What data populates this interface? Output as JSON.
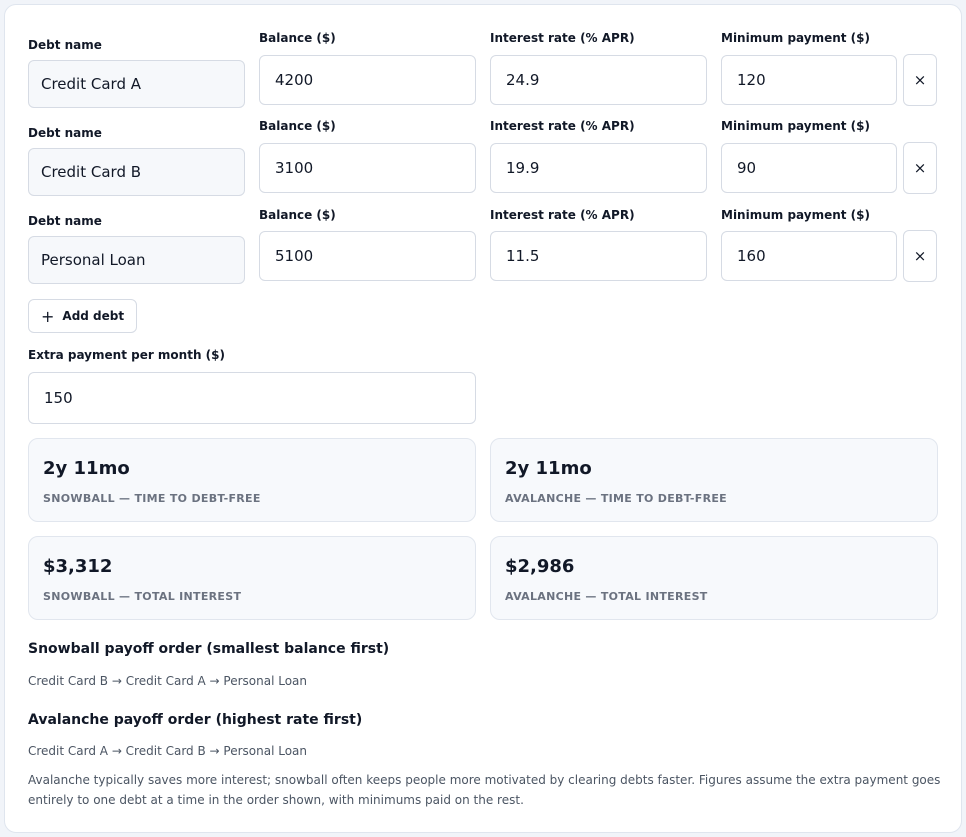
{
  "labels": {
    "name": "Debt name",
    "balance": "Balance ($)",
    "rate": "Interest rate (% APR)",
    "minimum": "Minimum payment ($)"
  },
  "debts": [
    {
      "name": "Credit Card A",
      "balance": "4200",
      "rate": "24.9",
      "minimum": "120"
    },
    {
      "name": "Credit Card B",
      "balance": "3100",
      "rate": "19.9",
      "minimum": "90"
    },
    {
      "name": "Personal Loan",
      "balance": "5100",
      "rate": "11.5",
      "minimum": "160"
    }
  ],
  "remove_label": "×",
  "add_debt": {
    "icon": "+",
    "label": "Add debt"
  },
  "extra": {
    "label": "Extra payment per month ($)",
    "value": "150"
  },
  "stats": [
    {
      "value": "2y 11mo",
      "caption": "SNOWBALL — TIME TO DEBT-FREE"
    },
    {
      "value": "2y 11mo",
      "caption": "AVALANCHE — TIME TO DEBT-FREE"
    },
    {
      "value": "$3,312",
      "caption": "SNOWBALL — TOTAL INTEREST"
    },
    {
      "value": "$2,986",
      "caption": "AVALANCHE — TOTAL INTEREST"
    }
  ],
  "snowball": {
    "title": "Snowball payoff order (smallest balance first)",
    "order": "Credit Card B → Credit Card A → Personal Loan"
  },
  "avalanche": {
    "title": "Avalanche payoff order (highest rate first)",
    "order": "Credit Card A → Credit Card B → Personal Loan"
  },
  "note": "Avalanche typically saves more interest; snowball often keeps people more motivated by clearing debts faster. Figures assume the extra payment goes entirely to one debt at a time in the order shown, with minimums paid on the rest."
}
